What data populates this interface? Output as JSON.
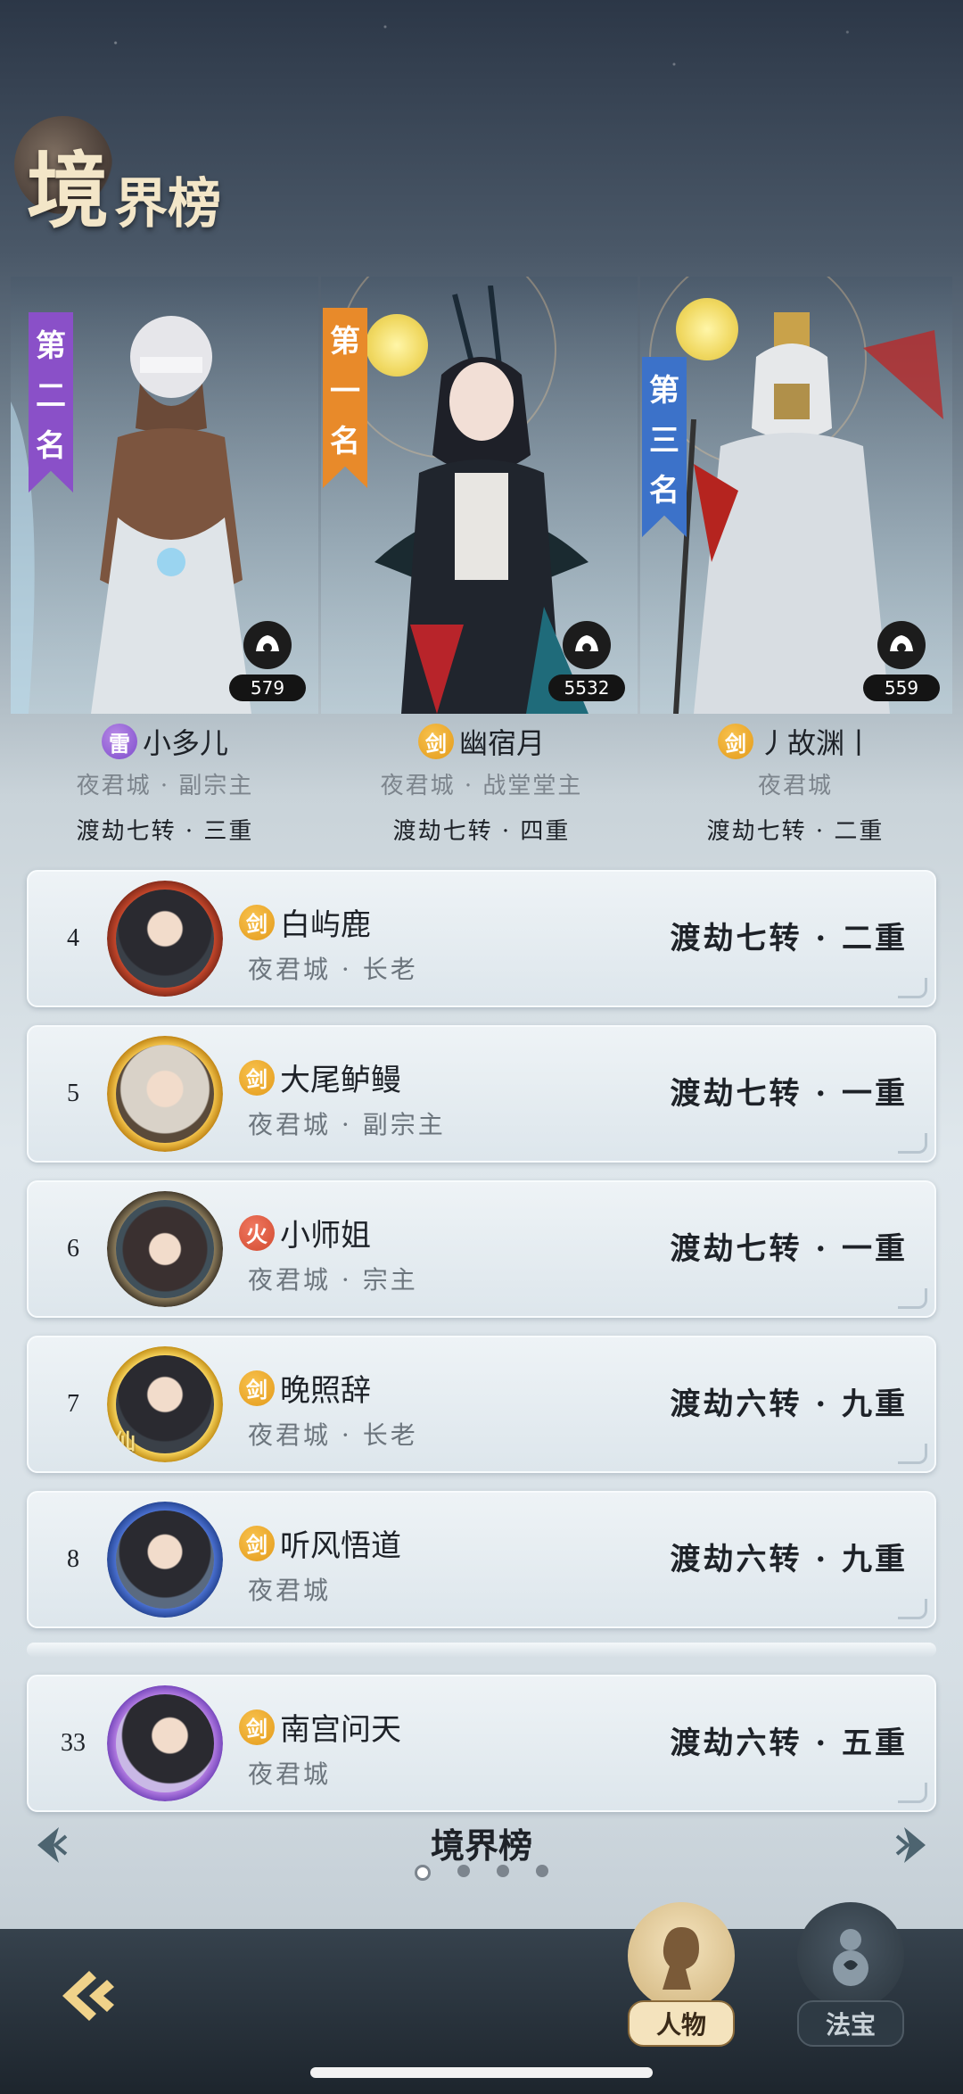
{
  "title": {
    "main": "境",
    "sub": "界榜"
  },
  "podium": [
    {
      "ribbon": [
        "第",
        "二",
        "名"
      ],
      "count": "579",
      "element": "雷",
      "name": "小多儿",
      "sect": "夜君城 · 副宗主",
      "realm": "渡劫七转 · 三重",
      "ribbon_color": "#8a50c8"
    },
    {
      "ribbon": [
        "第",
        "一",
        "名"
      ],
      "count": "5532",
      "element": "剑",
      "name": "幽宿月",
      "sect": "夜君城 · 战堂堂主",
      "realm": "渡劫七转 · 四重",
      "ribbon_color": "#e88a2a"
    },
    {
      "ribbon": [
        "第",
        "三",
        "名"
      ],
      "count": "559",
      "element": "剑",
      "name": "丿故渊丨",
      "sect": "夜君城",
      "realm": "渡劫七转 · 二重",
      "ribbon_color": "#3c72c9"
    }
  ],
  "rows": [
    {
      "rank": "4",
      "element": "剑",
      "name": "白屿鹿",
      "sect": "夜君城 · 长老",
      "realm": "渡劫七转 · 二重"
    },
    {
      "rank": "5",
      "element": "剑",
      "name": "大尾鲈鳗",
      "sect": "夜君城 · 副宗主",
      "realm": "渡劫七转 · 一重"
    },
    {
      "rank": "6",
      "element": "火",
      "name": "小师姐",
      "sect": "夜君城 · 宗主",
      "realm": "渡劫七转 · 一重"
    },
    {
      "rank": "7",
      "element": "剑",
      "name": "晚照辞",
      "sect": "夜君城 · 长老",
      "realm": "渡劫六转 · 九重",
      "avatar_tag": "仙"
    },
    {
      "rank": "8",
      "element": "剑",
      "name": "听风悟道",
      "sect": "夜君城",
      "realm": "渡劫六转 · 九重"
    }
  ],
  "self_row": {
    "rank": "33",
    "element": "剑",
    "name": "南宫问天",
    "sect": "夜君城",
    "realm": "渡劫六转 · 五重"
  },
  "pager": {
    "title": "境界榜",
    "page_count": 4,
    "active_page": 1
  },
  "tabs": {
    "character": "人物",
    "treasure": "法宝"
  },
  "colors": {
    "sword": "#eba12a",
    "thunder": "#8a5ad6",
    "fire": "#d9533a",
    "gold": "#f3e6c8"
  }
}
